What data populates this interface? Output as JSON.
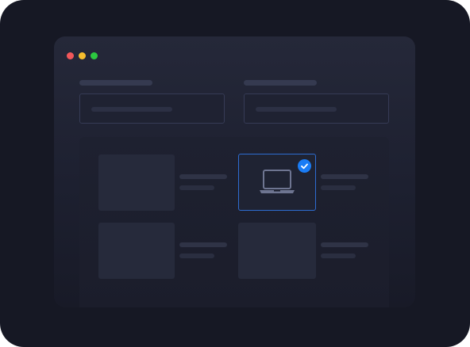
{
  "colors": {
    "traffic_red": "#f2575a",
    "traffic_yellow": "#f5bd2e",
    "traffic_green": "#2cc840",
    "selection_accent": "#1a7cf5"
  },
  "window_controls": [
    "close",
    "minimize",
    "maximize"
  ],
  "device_grid": {
    "selected_index": 1,
    "selected_icon": "laptop-icon",
    "badge_icon": "check-icon"
  }
}
